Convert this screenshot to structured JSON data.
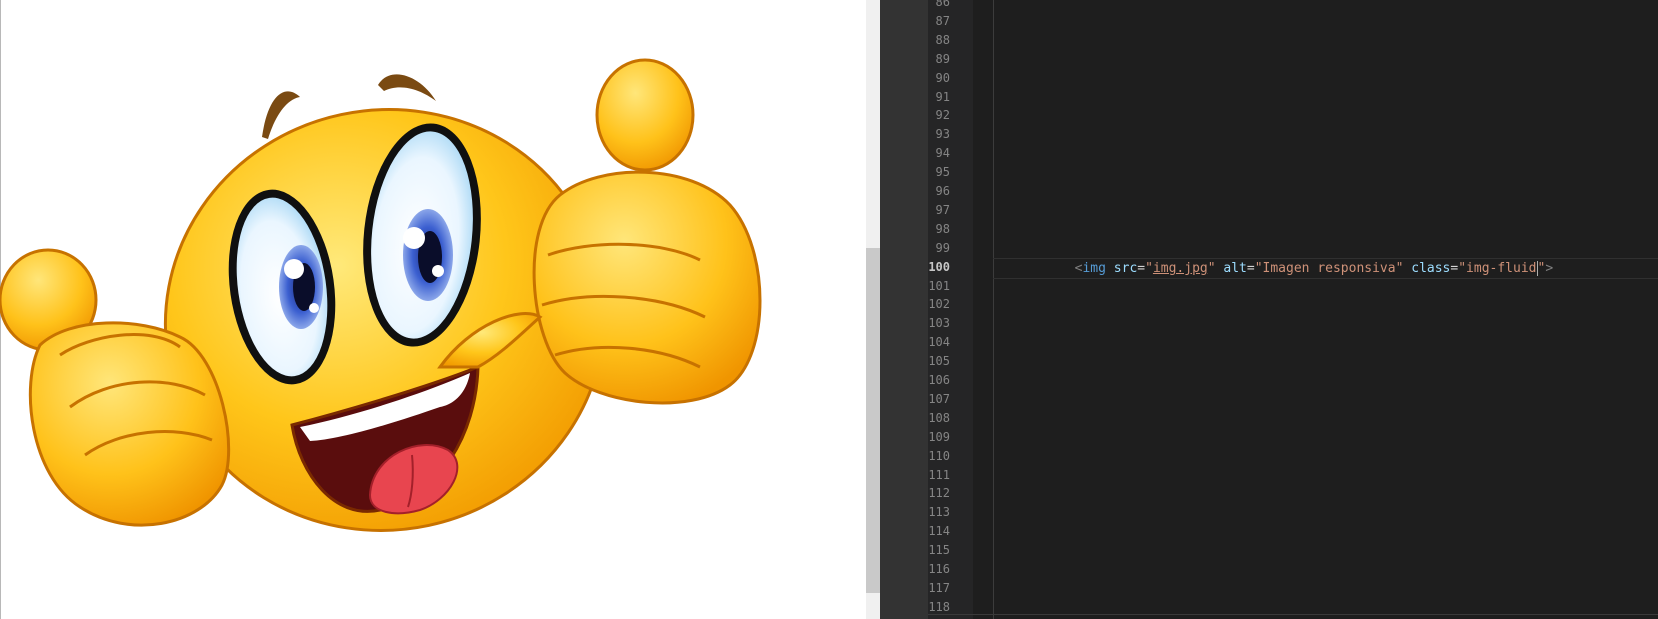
{
  "preview": {
    "image_icon": "thumbs-up-smiley-emoji"
  },
  "editor": {
    "line_numbers": [
      "86",
      "87",
      "88",
      "89",
      "90",
      "91",
      "92",
      "93",
      "94",
      "95",
      "96",
      "97",
      "98",
      "99",
      "100",
      "101",
      "102",
      "103",
      "104",
      "105",
      "106",
      "107",
      "108",
      "109",
      "110",
      "111",
      "112",
      "113",
      "114",
      "115",
      "116",
      "117",
      "118"
    ],
    "active_line": "100",
    "code": {
      "indent": "  ",
      "open": "<",
      "tag": "img",
      "src_attr": "src",
      "eq": "=",
      "q": "\"",
      "src_value": "img.jpg",
      "alt_attr": "alt",
      "alt_value": "Imagen responsiva",
      "class_attr": "class",
      "class_value": "img-fluid",
      "close": ">"
    }
  },
  "colors": {
    "editor_bg": "#1e1e1e",
    "tag": "#569cd6",
    "attribute": "#9cdcfe",
    "string": "#ce9178",
    "line_number": "#858585"
  }
}
